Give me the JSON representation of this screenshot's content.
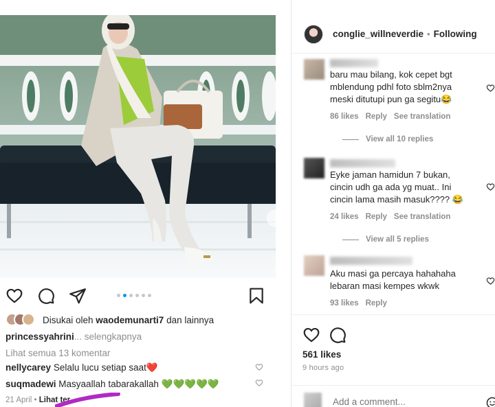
{
  "post": {
    "liked_by_prefix": "Disukai oleh ",
    "liked_by_user": "waodemunarti7",
    "liked_by_suffix": " dan lainnya",
    "caption_user": "princessyahrini",
    "caption_more": "... selengkapnya",
    "view_all_comments": "Lihat semua 13 komentar",
    "comments": [
      {
        "user": "nellycarey",
        "text": "Selalu lucu setiap saat❤️"
      },
      {
        "user": "suqmadewi",
        "text": "Masyaallah tabarakallah 💚💚💚💚💚"
      }
    ],
    "date": "21 April",
    "date_sep": " • ",
    "see_translation": "Lihat ter",
    "carousel": {
      "count": 6,
      "active": 1
    }
  },
  "panel": {
    "username": "conglie_willneverdie",
    "separator": "•",
    "follow_status": "Following",
    "comments": [
      {
        "text": "baru mau bilang, kok cepet bgt\nmblendung pdhl foto sblm2nya\nmeski ditutupi pun ga segitu😂",
        "likes": "86 likes",
        "reply": "Reply",
        "translate": "See translation",
        "view_replies": "View all 10 replies"
      },
      {
        "text": "Eyke jaman hamidun 7 bukan,\ncincin udh ga ada yg muat.. Ini\ncincin lama masih masuk???? 😂",
        "likes": "24 likes",
        "reply": "Reply",
        "translate": "See translation",
        "view_replies": "View all 5 replies"
      },
      {
        "text": "Aku masi ga percaya hahahaha\nlebaran masi kempes wkwk",
        "likes": "93 likes",
        "reply": "Reply"
      }
    ],
    "likes_count": "561 likes",
    "time_ago": "9 hours ago",
    "add_comment_placeholder": "Add a comment..."
  },
  "colors": {
    "accent_blue": "#0095f6",
    "scribble_purple": "#b02bc2",
    "heart_red": "#ed4956"
  },
  "icons": [
    "heart-icon",
    "comment-icon",
    "share-icon",
    "bookmark-icon",
    "chevron-right-icon",
    "emoji-icon"
  ]
}
